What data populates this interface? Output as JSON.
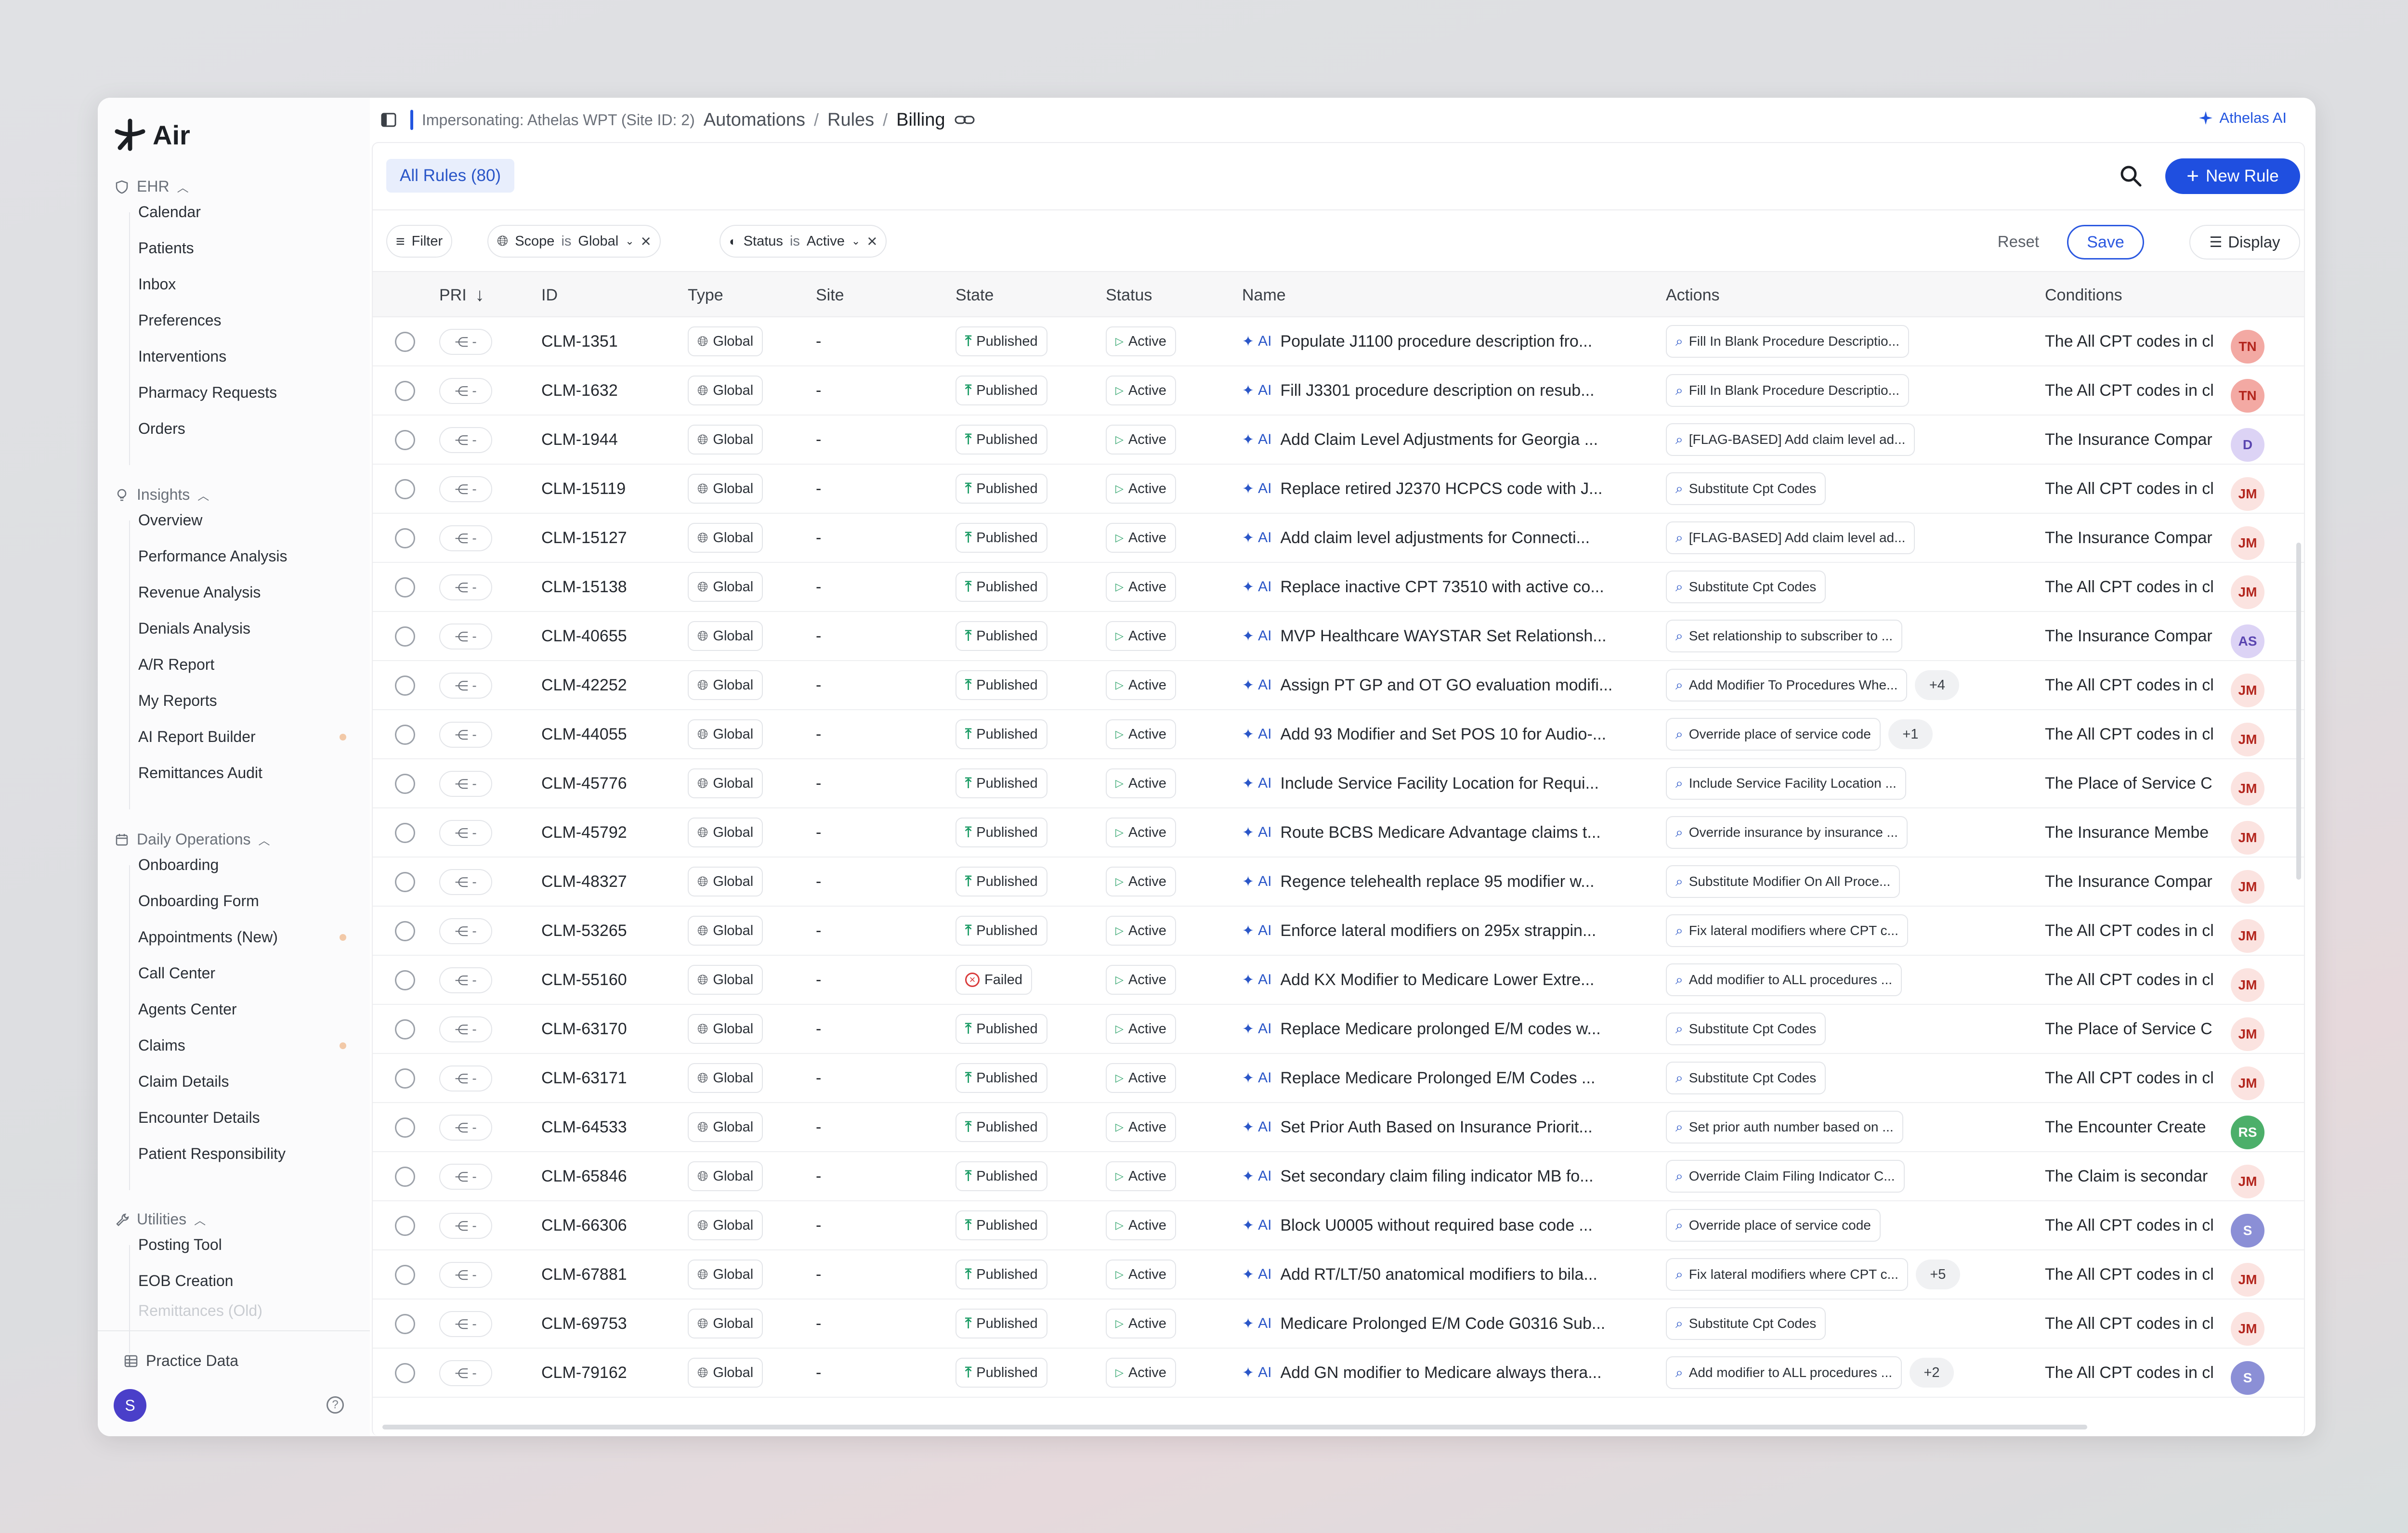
{
  "app": {
    "name": "Air"
  },
  "sidebar": {
    "sections": [
      {
        "label": "EHR",
        "icon": "shield-icon",
        "items": [
          {
            "label": "Calendar"
          },
          {
            "label": "Patients"
          },
          {
            "label": "Inbox"
          },
          {
            "label": "Preferences"
          },
          {
            "label": "Interventions"
          },
          {
            "label": "Pharmacy Requests"
          },
          {
            "label": "Orders"
          }
        ]
      },
      {
        "label": "Insights",
        "icon": "lightbulb-icon",
        "items": [
          {
            "label": "Overview"
          },
          {
            "label": "Performance Analysis"
          },
          {
            "label": "Revenue Analysis"
          },
          {
            "label": "Denials Analysis"
          },
          {
            "label": "A/R Report"
          },
          {
            "label": "My Reports"
          },
          {
            "label": "AI Report Builder",
            "dot": true
          },
          {
            "label": "Remittances Audit"
          }
        ]
      },
      {
        "label": "Daily Operations",
        "icon": "calendar-icon",
        "items": [
          {
            "label": "Onboarding"
          },
          {
            "label": "Onboarding Form"
          },
          {
            "label": "Appointments (New)",
            "dot": true
          },
          {
            "label": "Call Center"
          },
          {
            "label": "Agents Center"
          },
          {
            "label": "Claims",
            "dot": true
          },
          {
            "label": "Claim Details"
          },
          {
            "label": "Encounter Details"
          },
          {
            "label": "Patient Responsibility"
          }
        ]
      },
      {
        "label": "Utilities",
        "icon": "wrench-icon",
        "items": [
          {
            "label": "Posting Tool"
          },
          {
            "label": "EOB Creation"
          },
          {
            "label": "Remittances (Old)"
          }
        ]
      }
    ],
    "practice_data": "Practice Data",
    "user_initial": "S"
  },
  "header": {
    "impersonating": "Impersonating: Athelas WPT (Site ID: 2)",
    "breadcrumbs": [
      "Automations",
      "Rules",
      "Billing"
    ],
    "ai_button": "Athelas AI"
  },
  "toolbar": {
    "all_rules": "All Rules (80)",
    "new_rule": "New Rule",
    "filter": "Filter",
    "scope_label": "Scope",
    "scope_op": "is",
    "scope_value": "Global",
    "status_label": "Status",
    "status_op": "is",
    "status_value": "Active",
    "reset": "Reset",
    "save": "Save",
    "display": "Display"
  },
  "table": {
    "columns": [
      "PRI",
      "ID",
      "Type",
      "Site",
      "State",
      "Status",
      "Name",
      "Actions",
      "Conditions"
    ],
    "ai_label": "AI",
    "rows": [
      {
        "pri": "-",
        "id": "CLM-1351",
        "type": "Global",
        "site": "-",
        "state": "Published",
        "status": "Active",
        "name": "Populate J1100 procedure description fro...",
        "action": "Fill In Blank Procedure Descriptio...",
        "extra": "",
        "condition": "The All CPT codes in cl",
        "avatar": "TN",
        "avatar_bg": "#f3a9a3",
        "avatar_fg": "#b3261e"
      },
      {
        "pri": "-",
        "id": "CLM-1632",
        "type": "Global",
        "site": "-",
        "state": "Published",
        "status": "Active",
        "name": "Fill J3301 procedure description on resub...",
        "action": "Fill In Blank Procedure Descriptio...",
        "extra": "",
        "condition": "The All CPT codes in cl",
        "avatar": "TN",
        "avatar_bg": "#f3a9a3",
        "avatar_fg": "#b3261e"
      },
      {
        "pri": "-",
        "id": "CLM-1944",
        "type": "Global",
        "site": "-",
        "state": "Published",
        "status": "Active",
        "name": "Add Claim Level Adjustments for Georgia ...",
        "action": "[FLAG-BASED] Add claim level ad...",
        "extra": "",
        "condition": "The Insurance Compar",
        "avatar": "D",
        "avatar_bg": "#dcd3f5",
        "avatar_fg": "#5a45b0"
      },
      {
        "pri": "-",
        "id": "CLM-15119",
        "type": "Global",
        "site": "-",
        "state": "Published",
        "status": "Active",
        "name": "Replace retired J2370 HCPCS code with J...",
        "action": "Substitute Cpt Codes",
        "extra": "",
        "condition": "The All CPT codes in cl",
        "avatar": "JM",
        "avatar_bg": "#fbe3e0",
        "avatar_fg": "#b3261e"
      },
      {
        "pri": "-",
        "id": "CLM-15127",
        "type": "Global",
        "site": "-",
        "state": "Published",
        "status": "Active",
        "name": "Add claim level adjustments for Connecti...",
        "action": "[FLAG-BASED] Add claim level ad...",
        "extra": "",
        "condition": "The Insurance Compar",
        "avatar": "JM",
        "avatar_bg": "#fbe3e0",
        "avatar_fg": "#b3261e"
      },
      {
        "pri": "-",
        "id": "CLM-15138",
        "type": "Global",
        "site": "-",
        "state": "Published",
        "status": "Active",
        "name": "Replace inactive CPT 73510 with active co...",
        "action": "Substitute Cpt Codes",
        "extra": "",
        "condition": "The All CPT codes in cl",
        "avatar": "JM",
        "avatar_bg": "#fbe3e0",
        "avatar_fg": "#b3261e"
      },
      {
        "pri": "-",
        "id": "CLM-40655",
        "type": "Global",
        "site": "-",
        "state": "Published",
        "status": "Active",
        "name": "MVP Healthcare WAYSTAR Set Relationsh...",
        "action": "Set relationship to subscriber to ...",
        "extra": "",
        "condition": "The Insurance Compar",
        "avatar": "AS",
        "avatar_bg": "#dcd3f5",
        "avatar_fg": "#5a45b0"
      },
      {
        "pri": "-",
        "id": "CLM-42252",
        "type": "Global",
        "site": "-",
        "state": "Published",
        "status": "Active",
        "name": "Assign PT GP and OT GO evaluation modifi...",
        "action": "Add Modifier To Procedures Whe...",
        "extra": "+4",
        "condition": "The All CPT codes in cl",
        "avatar": "JM",
        "avatar_bg": "#fbe3e0",
        "avatar_fg": "#b3261e"
      },
      {
        "pri": "-",
        "id": "CLM-44055",
        "type": "Global",
        "site": "-",
        "state": "Published",
        "status": "Active",
        "name": "Add 93 Modifier and Set POS 10 for Audio-...",
        "action": "Override place of service code",
        "extra": "+1",
        "condition": "The All CPT codes in cl",
        "avatar": "JM",
        "avatar_bg": "#fbe3e0",
        "avatar_fg": "#b3261e"
      },
      {
        "pri": "-",
        "id": "CLM-45776",
        "type": "Global",
        "site": "-",
        "state": "Published",
        "status": "Active",
        "name": "Include Service Facility Location for Requi...",
        "action": "Include Service Facility Location ...",
        "extra": "",
        "condition": "The Place of Service C",
        "avatar": "JM",
        "avatar_bg": "#fbe3e0",
        "avatar_fg": "#b3261e"
      },
      {
        "pri": "-",
        "id": "CLM-45792",
        "type": "Global",
        "site": "-",
        "state": "Published",
        "status": "Active",
        "name": "Route BCBS Medicare Advantage claims t...",
        "action": "Override insurance by insurance ...",
        "extra": "",
        "condition": "The Insurance Membe",
        "avatar": "JM",
        "avatar_bg": "#fbe3e0",
        "avatar_fg": "#b3261e"
      },
      {
        "pri": "-",
        "id": "CLM-48327",
        "type": "Global",
        "site": "-",
        "state": "Published",
        "status": "Active",
        "name": "Regence telehealth replace 95 modifier w...",
        "action": "Substitute Modifier On All Proce...",
        "extra": "",
        "condition": "The Insurance Compar",
        "avatar": "JM",
        "avatar_bg": "#fbe3e0",
        "avatar_fg": "#b3261e"
      },
      {
        "pri": "-",
        "id": "CLM-53265",
        "type": "Global",
        "site": "-",
        "state": "Published",
        "status": "Active",
        "name": "Enforce lateral modifiers on 295x strappin...",
        "action": "Fix lateral modifiers where CPT c...",
        "extra": "",
        "condition": "The All CPT codes in cl",
        "avatar": "JM",
        "avatar_bg": "#fbe3e0",
        "avatar_fg": "#b3261e"
      },
      {
        "pri": "-",
        "id": "CLM-55160",
        "type": "Global",
        "site": "-",
        "state": "Failed",
        "status": "Active",
        "name": "Add KX Modifier to Medicare Lower Extre...",
        "action": "Add modifier to ALL procedures ...",
        "extra": "",
        "condition": "The All CPT codes in cl",
        "avatar": "JM",
        "avatar_bg": "#fbe3e0",
        "avatar_fg": "#b3261e"
      },
      {
        "pri": "-",
        "id": "CLM-63170",
        "type": "Global",
        "site": "-",
        "state": "Published",
        "status": "Active",
        "name": "Replace Medicare prolonged E/M codes w...",
        "action": "Substitute Cpt Codes",
        "extra": "",
        "condition": "The Place of Service C",
        "avatar": "JM",
        "avatar_bg": "#fbe3e0",
        "avatar_fg": "#b3261e"
      },
      {
        "pri": "-",
        "id": "CLM-63171",
        "type": "Global",
        "site": "-",
        "state": "Published",
        "status": "Active",
        "name": "Replace Medicare Prolonged E/M Codes ...",
        "action": "Substitute Cpt Codes",
        "extra": "",
        "condition": "The All CPT codes in cl",
        "avatar": "JM",
        "avatar_bg": "#fbe3e0",
        "avatar_fg": "#b3261e"
      },
      {
        "pri": "-",
        "id": "CLM-64533",
        "type": "Global",
        "site": "-",
        "state": "Published",
        "status": "Active",
        "name": "Set Prior Auth Based on Insurance Priorit...",
        "action": "Set prior auth number based on ...",
        "extra": "",
        "condition": "The Encounter Create",
        "avatar": "RS",
        "avatar_bg": "#4caf6a",
        "avatar_fg": "#ffffff"
      },
      {
        "pri": "-",
        "id": "CLM-65846",
        "type": "Global",
        "site": "-",
        "state": "Published",
        "status": "Active",
        "name": "Set secondary claim filing indicator MB fo...",
        "action": "Override Claim Filing Indicator C...",
        "extra": "",
        "condition": "The Claim is secondar",
        "avatar": "JM",
        "avatar_bg": "#fbe3e0",
        "avatar_fg": "#b3261e"
      },
      {
        "pri": "-",
        "id": "CLM-66306",
        "type": "Global",
        "site": "-",
        "state": "Published",
        "status": "Active",
        "name": "Block U0005 without required base code ...",
        "action": "Override place of service code",
        "extra": "",
        "condition": "The All CPT codes in cl",
        "avatar": "S",
        "avatar_bg": "#8b8fd6",
        "avatar_fg": "#ffffff"
      },
      {
        "pri": "-",
        "id": "CLM-67881",
        "type": "Global",
        "site": "-",
        "state": "Published",
        "status": "Active",
        "name": "Add RT/LT/50 anatomical modifiers to bila...",
        "action": "Fix lateral modifiers where CPT c...",
        "extra": "+5",
        "condition": "The All CPT codes in cl",
        "avatar": "JM",
        "avatar_bg": "#fbe3e0",
        "avatar_fg": "#b3261e"
      },
      {
        "pri": "-",
        "id": "CLM-69753",
        "type": "Global",
        "site": "-",
        "state": "Published",
        "status": "Active",
        "name": "Medicare Prolonged E/M Code G0316 Sub...",
        "action": "Substitute Cpt Codes",
        "extra": "",
        "condition": "The All CPT codes in cl",
        "avatar": "JM",
        "avatar_bg": "#fbe3e0",
        "avatar_fg": "#b3261e"
      },
      {
        "pri": "-",
        "id": "CLM-79162",
        "type": "Global",
        "site": "-",
        "state": "Published",
        "status": "Active",
        "name": "Add GN modifier to Medicare always thera...",
        "action": "Add modifier to ALL procedures ...",
        "extra": "+2",
        "condition": "The All CPT codes in cl",
        "avatar": "S",
        "avatar_bg": "#8b8fd6",
        "avatar_fg": "#ffffff"
      }
    ]
  },
  "colors": {
    "accent": "#1f4fe0",
    "published": "#1a9b64",
    "failed": "#d93b3b",
    "active": "#2ea36a"
  }
}
